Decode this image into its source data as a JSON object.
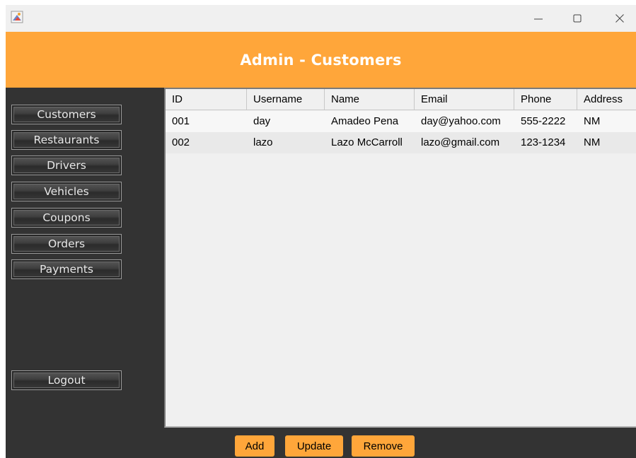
{
  "window": {
    "controls": {
      "minimize_icon": "minimize-icon",
      "maximize_icon": "maximize-icon",
      "close_icon": "close-icon"
    }
  },
  "header": {
    "title": "Admin - Customers",
    "color": "#ffa63a"
  },
  "sidebar": {
    "items": [
      {
        "label": "Customers"
      },
      {
        "label": "Restaurants"
      },
      {
        "label": "Drivers"
      },
      {
        "label": "Vehicles"
      },
      {
        "label": "Coupons"
      },
      {
        "label": "Orders"
      },
      {
        "label": "Payments"
      }
    ],
    "logout_label": "Logout"
  },
  "table": {
    "columns": [
      "ID",
      "Username",
      "Name",
      "Email",
      "Phone",
      "Address"
    ],
    "rows": [
      [
        "001",
        "day",
        "Amadeo Pena",
        "day@yahoo.com",
        "555-2222",
        "NM"
      ],
      [
        "002",
        "lazo",
        "Lazo McCarroll",
        "lazo@gmail.com",
        "123-1234",
        "NM"
      ]
    ]
  },
  "actions": {
    "add_label": "Add",
    "update_label": "Update",
    "remove_label": "Remove"
  }
}
